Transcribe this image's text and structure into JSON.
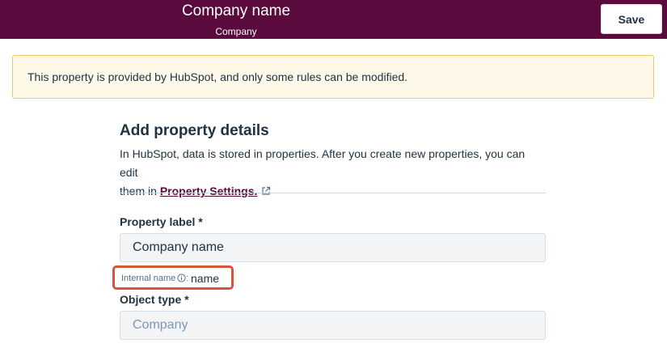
{
  "header": {
    "title": "Company name",
    "subtitle": "Company",
    "save_label": "Save",
    "bg_color": "#5a0a3c"
  },
  "alert": {
    "text": "This property is provided by HubSpot, and only some rules can be modified."
  },
  "details": {
    "heading": "Add property details",
    "description_line1": "In HubSpot, data is stored in properties. After you create new properties, you can edit",
    "description_prefix": "them in ",
    "settings_link": "Property Settings.",
    "link_icon": "external-link-icon"
  },
  "property_label": {
    "label": "Property label *",
    "value": "Company name"
  },
  "internal_name": {
    "label": "Internal name",
    "info_icon": "info-icon",
    "separator": ":",
    "value": "name",
    "highlight_color": "#d6553a"
  },
  "object_type": {
    "label": "Object type *",
    "value": "Company"
  }
}
